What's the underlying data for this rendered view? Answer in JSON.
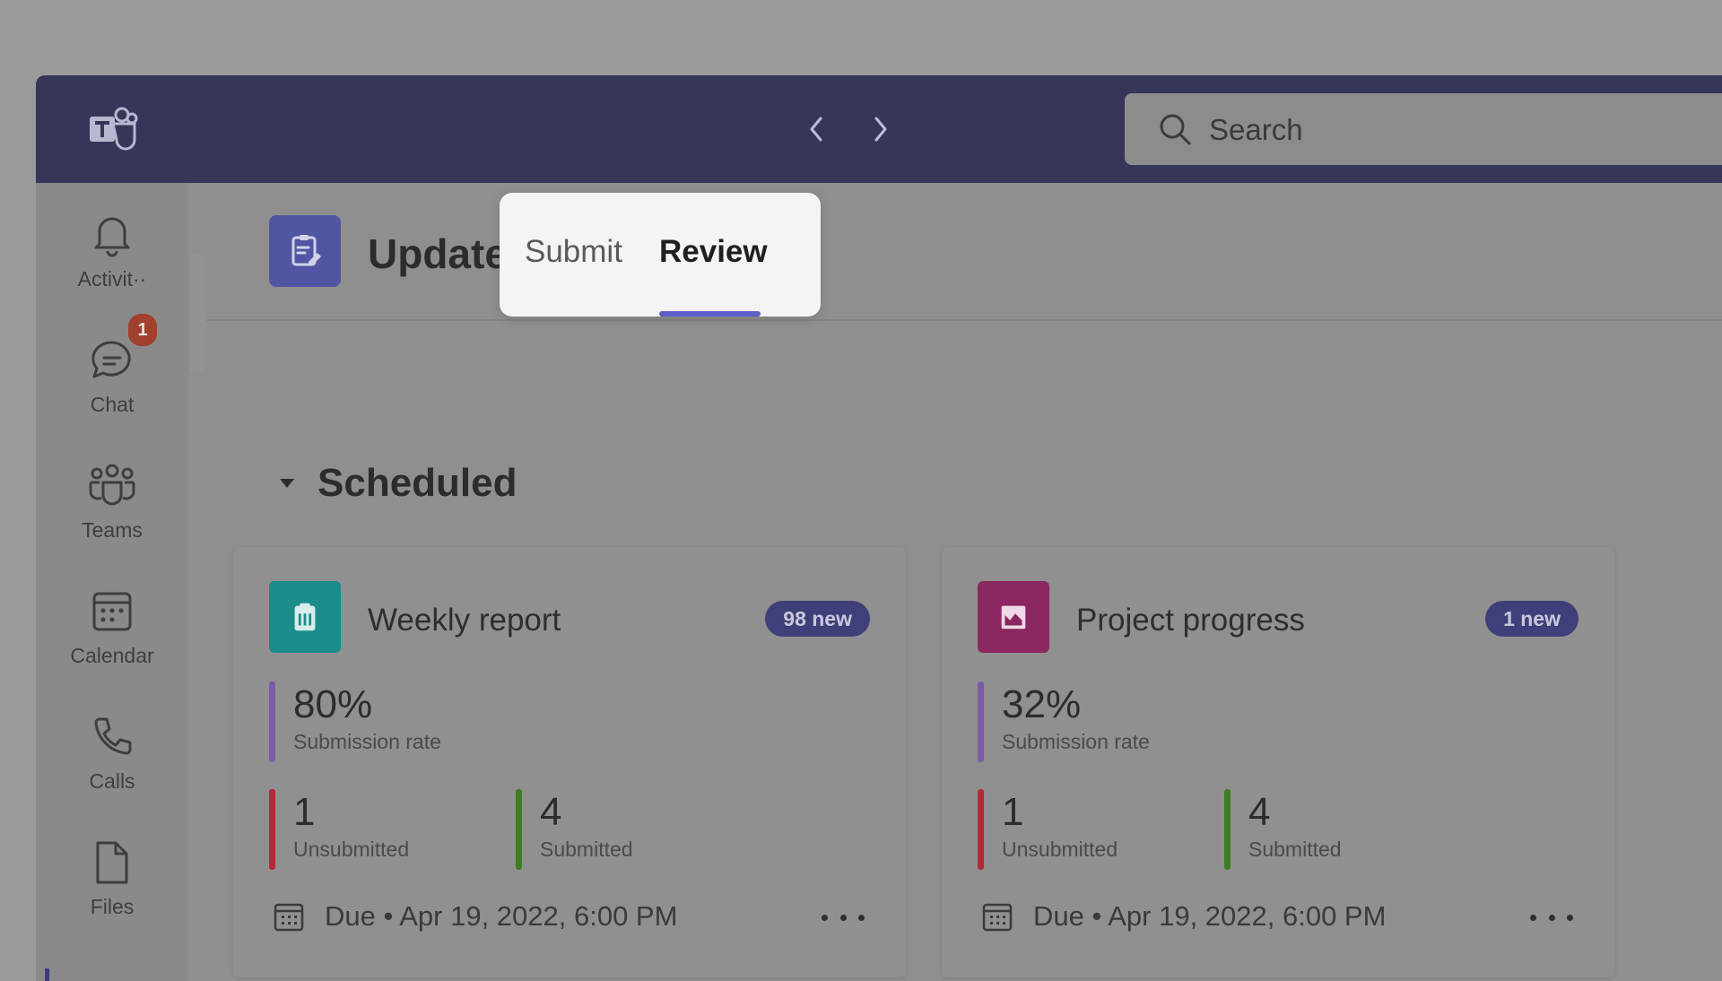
{
  "search": {
    "placeholder": "Search"
  },
  "rail": {
    "items": [
      {
        "label": "Activit··",
        "icon": "bell-icon"
      },
      {
        "label": "Chat",
        "icon": "chat-icon",
        "badge": "1"
      },
      {
        "label": "Teams",
        "icon": "teams-icon"
      },
      {
        "label": "Calendar",
        "icon": "calendar-icon"
      },
      {
        "label": "Calls",
        "icon": "phone-icon"
      },
      {
        "label": "Files",
        "icon": "file-icon"
      }
    ]
  },
  "app": {
    "title": "Updates",
    "icon": "updates-clipboard-icon"
  },
  "tabs": [
    {
      "label": "Submit",
      "active": false
    },
    {
      "label": "Review",
      "active": true
    }
  ],
  "section": {
    "label": "Scheduled",
    "expanded": true
  },
  "cards": [
    {
      "title": "Weekly report",
      "icon": "clipboard-icon",
      "icon_color": "#1c8c8a",
      "badge": "98 new",
      "rate": {
        "value": "80%",
        "label": "Submission rate"
      },
      "unsubmitted": {
        "value": "1",
        "label": "Unsubmitted"
      },
      "submitted": {
        "value": "4",
        "label": "Submitted"
      },
      "due": "Due • Apr 19, 2022, 6:00 PM"
    },
    {
      "title": "Project progress",
      "icon": "chart-icon",
      "icon_color": "#8a2760",
      "badge": "1 new",
      "rate": {
        "value": "32%",
        "label": "Submission rate"
      },
      "unsubmitted": {
        "value": "1",
        "label": "Unsubmitted"
      },
      "submitted": {
        "value": "4",
        "label": "Submitted"
      },
      "due": "Due • Apr 19, 2022, 6:00 PM"
    }
  ],
  "colors": {
    "titlebar": "#363659",
    "accent": "#5b5fc7",
    "rate_bar": "#7b5ba8",
    "unsubmitted_bar": "#b4293a",
    "submitted_bar": "#3f7d22"
  }
}
